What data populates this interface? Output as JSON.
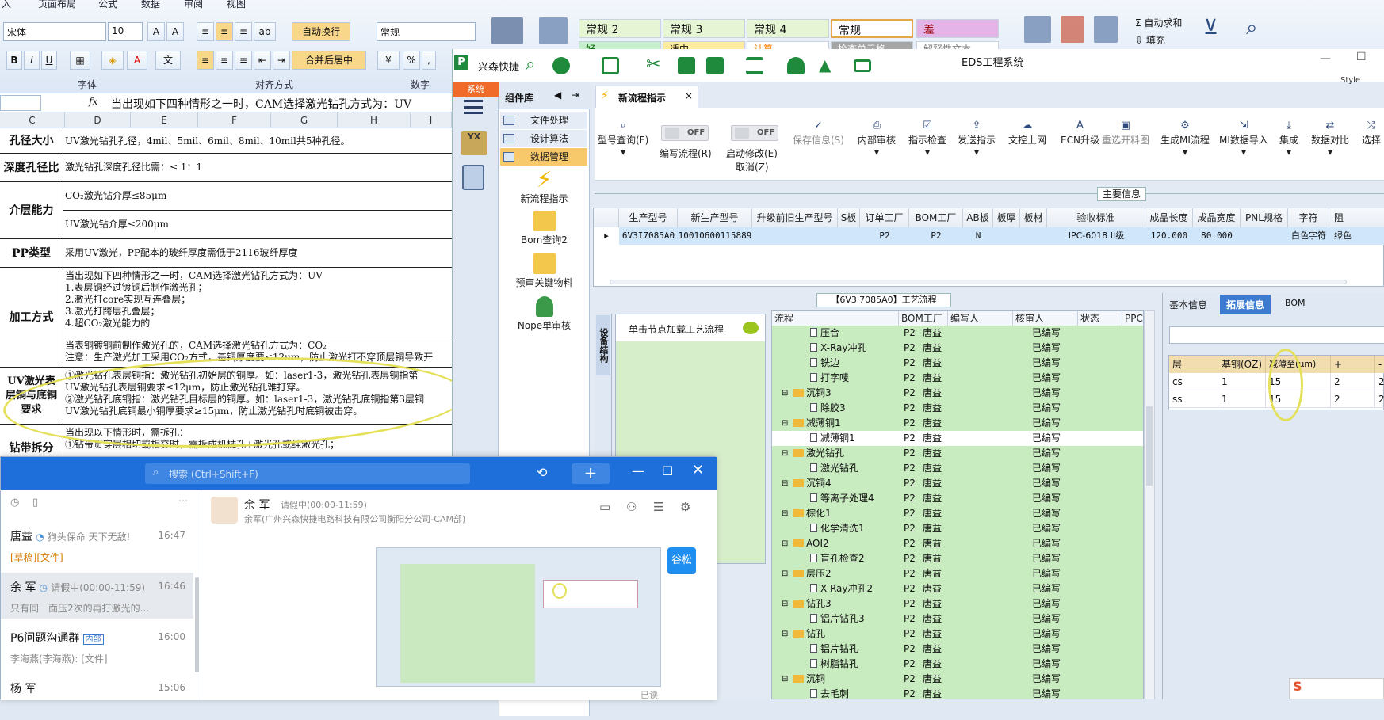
{
  "excel": {
    "ribbon_tabs": [
      "入",
      "页面布局",
      "公式",
      "数据",
      "审阅",
      "视图"
    ],
    "font_name": "宋体",
    "font_size": "10",
    "wrap_text": "自动换行",
    "merge_center": "合并后居中",
    "number_format": "常规",
    "group_font": "字体",
    "group_align": "对齐方式",
    "group_number": "数字",
    "styles": [
      "常规 2",
      "常规 3",
      "常规 4",
      "常规",
      "差",
      "好",
      "适中",
      "计算",
      "检查单元格",
      "解释性文本"
    ],
    "right_tools": [
      "自动求和",
      "填充"
    ],
    "formula_content": "当出现如下四种情形之一时，CAM选择激光钻孔方式为：UV",
    "columns": [
      "C",
      "D",
      "E",
      "F",
      "G",
      "H",
      "I"
    ],
    "rows": [
      {
        "head": "孔径大小",
        "text": "UV激光钻孔孔径，4mil、5mil、6mil、8mil、10mil共5种孔径。"
      },
      {
        "head": "深度孔径比",
        "text": "激光钻孔深度孔径比需：≤ 1：1"
      },
      {
        "head": "介层能力",
        "text": "CO₂激光钻介厚≤85μm",
        "text2": "UV激光钻介厚≤200μm"
      },
      {
        "head": "PP类型",
        "text": "采用UV激光，PP配本的玻纤厚度需低于2116玻纤厚度"
      },
      {
        "head": "加工方式",
        "text": "当出现如下四种情形之一时，CAM选择激光钻孔方式为：UV\n1.表层铜经过镀铜后制作激光孔；\n2.激光打core实现互连叠层；\n3.激光打跨层孔叠层；\n4.超CO₂激光能力的",
        "text2": "当表铜镀铜前制作激光孔的，CAM选择激光钻孔方式为：CO₂\n注意：生产激光加工采用CO₂方式，基铜厚度要≤12um，防止激光打不穿顶层铜导致开"
      },
      {
        "head": "UV激光表层铜与底铜要求",
        "text": "①激光钻孔表层铜指：激光钻孔初始层的铜厚。如：laser1-3，激光钻孔表层铜指第\nUV激光钻孔表层铜要求≤12μm，防止激光钻孔难打穿。\n②激光钻孔底铜指：激光钻孔目标层的铜厚。如：laser1-3，激光钻孔底铜指第3层铜\nUV激光钻孔底铜最小铜厚要求≥15μm，防止激光钻孔时底铜被击穿。"
      },
      {
        "head": "钻带拆分",
        "text": "当出现以下情形时，需拆孔：\n①钻带贯穿层相切或相交时，需拆成机械孔+激光孔或纯激光孔；"
      }
    ]
  },
  "eds": {
    "app_name": "兴森快捷",
    "window_title": "EDS工程系统",
    "style_label": "Style",
    "system_tab": "系统",
    "component_lib": "组件库",
    "components": [
      "文件处理",
      "设计算法",
      "数据管理"
    ],
    "big_items": [
      "新流程指示",
      "Bom查询2",
      "预审关键物料",
      "Nope单审核"
    ],
    "doc_tab": "新流程指示",
    "toolbar": {
      "query": "型号查询(F)",
      "edit_flow": "编写流程(R)",
      "start_edit": "启动修改(E)",
      "cancel": "取消(Z)",
      "off": "OFF",
      "save": "保存信息(S)",
      "internal_review": "内部审核",
      "instr_check": "指示检查",
      "send_instr": "发送指示",
      "doc_upload": "文控上网",
      "ecn": "ECN升级",
      "reselect": "重选开料图",
      "gen_mi": "生成MI流程",
      "mi_import": "MI数据导入",
      "integrate": "集成",
      "compare": "数据对比",
      "select": "选择"
    },
    "main_info_title": "主要信息",
    "grid_headers": [
      "生产型号",
      "新生产型号",
      "升级前旧生产型号",
      "S板",
      "订单工厂",
      "BOM工厂",
      "AB板",
      "板厚",
      "板材",
      "验收标准",
      "成品长度",
      "成品宽度",
      "PNL规格",
      "字符",
      "阻"
    ],
    "grid_row": [
      "6V3I7085A0",
      "10010600115889",
      "",
      "",
      "P2",
      "P2",
      "N",
      "",
      "",
      "IPC-6018 II级",
      "120.000",
      "80.000",
      "",
      "白色字符",
      "绿色"
    ],
    "proc_title": "【6V3I7085A0】工艺流程",
    "side_label": "设备结构",
    "proc_hint": "单击节点加载工艺流程",
    "tree_headers": [
      "流程",
      "BOM工厂",
      "编写人",
      "核审人",
      "状态",
      "PPC"
    ],
    "tree_rows": [
      {
        "name": "压合",
        "level": 2,
        "folder": false
      },
      {
        "name": "X-Ray冲孔",
        "level": 2,
        "folder": false
      },
      {
        "name": "铣边",
        "level": 2,
        "folder": false
      },
      {
        "name": "打字唛",
        "level": 2,
        "folder": false
      },
      {
        "name": "沉铜3",
        "level": 1,
        "folder": true
      },
      {
        "name": "除胶3",
        "level": 2,
        "folder": false
      },
      {
        "name": "减薄铜1",
        "level": 1,
        "folder": true
      },
      {
        "name": "减薄铜1",
        "level": 2,
        "folder": false
      },
      {
        "name": "激光钻孔",
        "level": 1,
        "folder": true
      },
      {
        "name": "激光钻孔",
        "level": 2,
        "folder": false
      },
      {
        "name": "沉铜4",
        "level": 1,
        "folder": true
      },
      {
        "name": "等离子处理4",
        "level": 2,
        "folder": false
      },
      {
        "name": "棕化1",
        "level": 1,
        "folder": true
      },
      {
        "name": "化学清洗1",
        "level": 2,
        "folder": false
      },
      {
        "name": "AOI2",
        "level": 1,
        "folder": true
      },
      {
        "name": "盲孔检查2",
        "level": 2,
        "folder": false
      },
      {
        "name": "层压2",
        "level": 1,
        "folder": true
      },
      {
        "name": "X-Ray冲孔2",
        "level": 2,
        "folder": false
      },
      {
        "name": "钻孔3",
        "level": 1,
        "folder": true
      },
      {
        "name": "铝片钻孔3",
        "level": 2,
        "folder": false
      },
      {
        "name": "钻孔",
        "level": 1,
        "folder": true
      },
      {
        "name": "铝片钻孔",
        "level": 2,
        "folder": false
      },
      {
        "name": "树脂钻孔",
        "level": 2,
        "folder": false
      },
      {
        "name": "沉铜",
        "level": 1,
        "folder": true
      },
      {
        "name": "去毛刺",
        "level": 2,
        "folder": false
      }
    ],
    "tree_factory": "P2",
    "tree_author": "唐益",
    "tree_status": "已编写",
    "right_tabs": [
      "基本信息",
      "拓展信息",
      "BOM"
    ],
    "layer_headers": [
      "层",
      "基铜(OZ)",
      "减薄至(μm)",
      "+",
      "-"
    ],
    "layer_rows": [
      [
        "cs",
        "1",
        "15",
        "2",
        "2"
      ],
      [
        "ss",
        "1",
        "15",
        "2",
        "2"
      ]
    ]
  },
  "chat": {
    "search_placeholder": "搜索 (Ctrl+Shift+F)",
    "contact_name": "余 军",
    "contact_status": "请假中(00:00-11:59)",
    "contact_org": "余军(广州兴森快捷电路科技有限公司衡阳分公司-CAM部)",
    "badge": "谷松",
    "read_label": "已读",
    "conversations": [
      {
        "name": "唐益",
        "status": "狗头保命 天下无敌!",
        "time": "16:47",
        "preview": "[草稿][文件]"
      },
      {
        "name": "余 军",
        "status": "请假中(00:00-11:59)",
        "time": "16:46",
        "preview": "只有同一面压2次的再打激光的..."
      },
      {
        "name": "P6问题沟通群",
        "status": "内部",
        "time": "16:00",
        "preview": "李海燕(李海燕): [文件]"
      },
      {
        "name": "杨 军",
        "status": "",
        "time": "15:06",
        "preview": ""
      }
    ]
  },
  "colors": {
    "accent": "#1e6fd9",
    "highlight": "#e5e05a",
    "tree_bg": "#c9ebc0",
    "selected": "#f7c96a"
  }
}
